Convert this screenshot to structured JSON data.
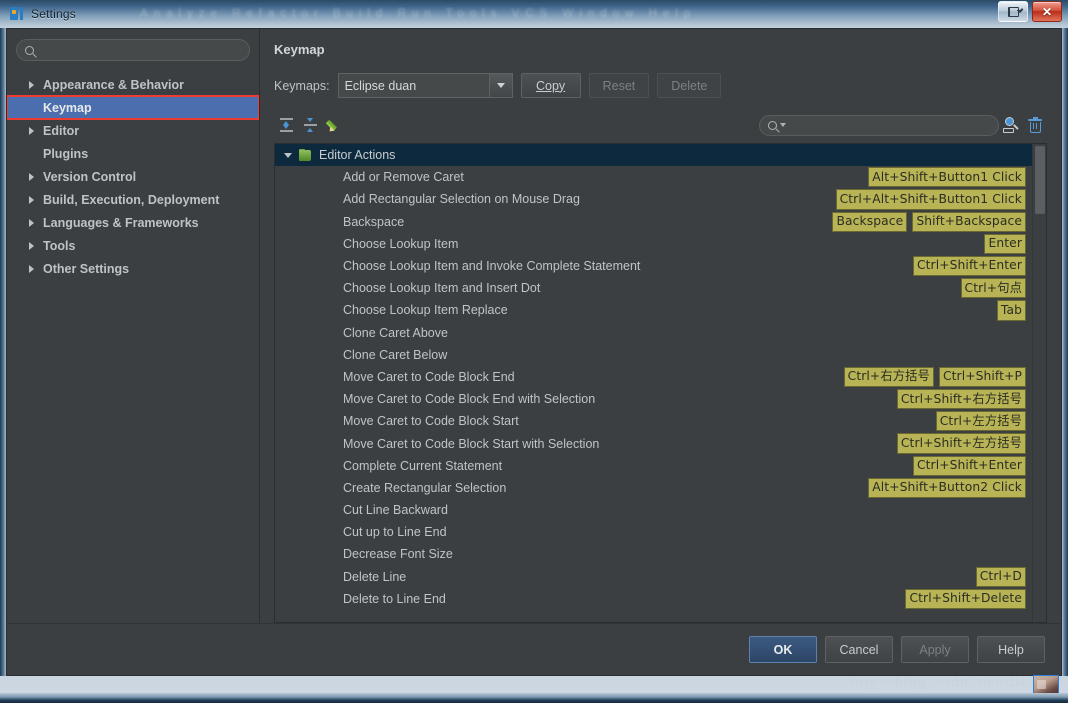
{
  "window": {
    "title": "Settings",
    "ghost_menu": "Analyze Refactor Build Run Tools VCS Window Help",
    "restore_label": "Restore",
    "close_label": "Close"
  },
  "left_pane": {
    "search_placeholder": "",
    "search_value": "",
    "search_icon": "search-icon",
    "items": [
      {
        "label": "Appearance & Behavior",
        "has_arrow": true,
        "selected": false,
        "highlight": false
      },
      {
        "label": "Keymap",
        "has_arrow": false,
        "selected": true,
        "highlight": true
      },
      {
        "label": "Editor",
        "has_arrow": true,
        "selected": false,
        "highlight": false
      },
      {
        "label": "Plugins",
        "has_arrow": false,
        "selected": false,
        "highlight": false
      },
      {
        "label": "Version Control",
        "has_arrow": true,
        "selected": false,
        "highlight": false
      },
      {
        "label": "Build, Execution, Deployment",
        "has_arrow": true,
        "selected": false,
        "highlight": false
      },
      {
        "label": "Languages & Frameworks",
        "has_arrow": true,
        "selected": false,
        "highlight": false
      },
      {
        "label": "Tools",
        "has_arrow": true,
        "selected": false,
        "highlight": false
      },
      {
        "label": "Other Settings",
        "has_arrow": true,
        "selected": false,
        "highlight": false
      }
    ]
  },
  "right_pane": {
    "title": "Keymap",
    "keymaps_label": "Keymaps:",
    "keymap_selected": "Eclipse duan",
    "buttons": [
      {
        "label": "Copy",
        "mnemonic": "C",
        "disabled": false
      },
      {
        "label": "Reset",
        "mnemonic": "",
        "disabled": true
      },
      {
        "label": "Delete",
        "mnemonic": "",
        "disabled": true
      }
    ],
    "toolbar": {
      "expand_all": "expand-all-icon",
      "collapse_all": "collapse-all-icon",
      "edit": "edit-pencil-icon",
      "search_placeholder": "",
      "search_value": "",
      "find_shortcut": "find-by-shortcut-icon",
      "clear": "trash-icon"
    },
    "list": {
      "group": {
        "label": "Editor Actions",
        "expanded": true
      },
      "rows": [
        {
          "name": "Add or Remove Caret",
          "shortcuts": [
            "Alt+Shift+Button1 Click"
          ]
        },
        {
          "name": "Add Rectangular Selection on Mouse Drag",
          "shortcuts": [
            "Ctrl+Alt+Shift+Button1 Click"
          ]
        },
        {
          "name": "Backspace",
          "shortcuts": [
            "Backspace",
            "Shift+Backspace"
          ]
        },
        {
          "name": "Choose Lookup Item",
          "shortcuts": [
            "Enter"
          ]
        },
        {
          "name": "Choose Lookup Item and Invoke Complete Statement",
          "shortcuts": [
            "Ctrl+Shift+Enter"
          ]
        },
        {
          "name": "Choose Lookup Item and Insert Dot",
          "shortcuts": [
            "Ctrl+句点"
          ]
        },
        {
          "name": "Choose Lookup Item Replace",
          "shortcuts": [
            "Tab"
          ]
        },
        {
          "name": "Clone Caret Above",
          "shortcuts": []
        },
        {
          "name": "Clone Caret Below",
          "shortcuts": []
        },
        {
          "name": "Move Caret to Code Block End",
          "shortcuts": [
            "Ctrl+右方括号",
            "Ctrl+Shift+P"
          ]
        },
        {
          "name": "Move Caret to Code Block End with Selection",
          "shortcuts": [
            "Ctrl+Shift+右方括号"
          ]
        },
        {
          "name": "Move Caret to Code Block Start",
          "shortcuts": [
            "Ctrl+左方括号"
          ]
        },
        {
          "name": "Move Caret to Code Block Start with Selection",
          "shortcuts": [
            "Ctrl+Shift+左方括号"
          ]
        },
        {
          "name": "Complete Current Statement",
          "shortcuts": [
            "Ctrl+Shift+Enter"
          ]
        },
        {
          "name": "Create Rectangular Selection",
          "shortcuts": [
            "Alt+Shift+Button2 Click"
          ]
        },
        {
          "name": "Cut Line Backward",
          "shortcuts": []
        },
        {
          "name": "Cut up to Line End",
          "shortcuts": []
        },
        {
          "name": "Decrease Font Size",
          "shortcuts": []
        },
        {
          "name": "Delete Line",
          "shortcuts": [
            "Ctrl+D"
          ]
        },
        {
          "name": "Delete to Line End",
          "shortcuts": [
            "Ctrl+Shift+Delete"
          ]
        }
      ]
    }
  },
  "footer": {
    "ok": "OK",
    "cancel": "Cancel",
    "apply": "Apply",
    "help": "Help",
    "watermark": "http://blog. csdn. net/dlz_M"
  },
  "colors": {
    "accent_selection": "#4b6eaf",
    "highlight_box": "#ef3c32",
    "shortcut_badge": "#b8b456",
    "group_row": "#0d293e",
    "panel_bg": "#3c3f41"
  }
}
